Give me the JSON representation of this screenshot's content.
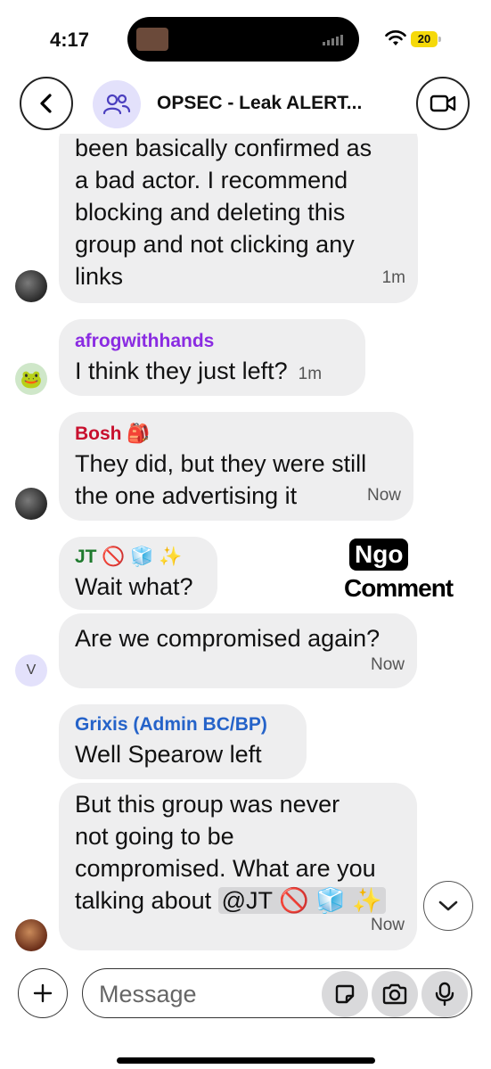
{
  "status_bar": {
    "time": "4:17",
    "battery": "20"
  },
  "header": {
    "title": "OPSEC - Leak ALERT...",
    "back_icon": "chevron-left-icon",
    "group_icon": "people-icon",
    "video_icon": "video-icon"
  },
  "messages": [
    {
      "lines": [
        "been basically confirmed as",
        "a bad actor. I recommend",
        "blocking and deleting this",
        "group and not clicking any",
        "links"
      ],
      "time": "1m"
    },
    {
      "sender": "afrogwithhands",
      "sender_color": "#8a2be2",
      "lines": [
        "I think they just left?"
      ],
      "time": "1m"
    },
    {
      "sender": "Bosh 🎒",
      "sender_color": "#c8102e",
      "lines": [
        "They did, but they were still",
        "the one advertising it"
      ],
      "time": "Now"
    },
    {
      "sender": "JT 🚫 🧊 ✨",
      "sender_color": "#1f7a2e",
      "lines": [
        "Wait what?"
      ]
    },
    {
      "lines": [
        "Are we compromised again?"
      ],
      "time": "Now"
    },
    {
      "sender": "Grixis (Admin BC/BP)",
      "sender_color": "#2563c9",
      "lines": [
        "Well Spearow left"
      ]
    },
    {
      "lines": [
        "But this group was never",
        "not going to be",
        "compromised. What are you",
        "talking about"
      ],
      "mention": "@JT 🚫 🧊 ✨",
      "time": "Now"
    }
  ],
  "avatars": {
    "frog": "🐸",
    "v": "V"
  },
  "watermark": {
    "top": "Ngo",
    "bottom": "Comment"
  },
  "composer": {
    "placeholder": "Message"
  },
  "colors": {
    "bubble": "#eeeeef",
    "group_avatar": "#e3e1fb",
    "battery": "#f5d90a"
  }
}
